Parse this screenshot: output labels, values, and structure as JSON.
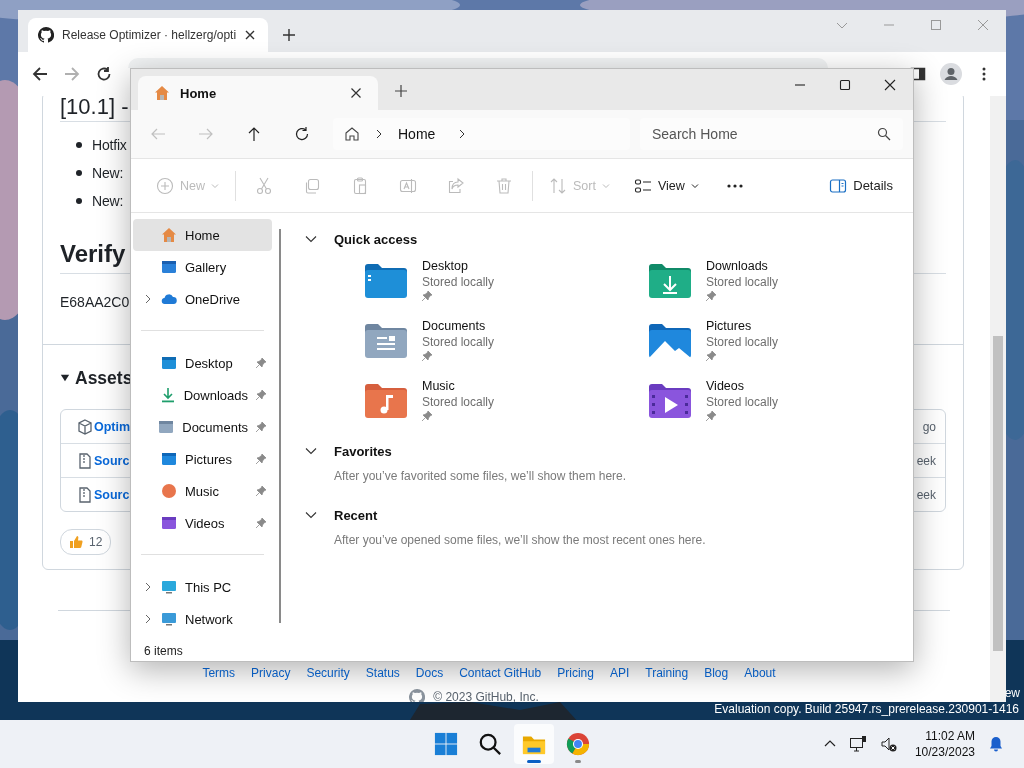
{
  "browser": {
    "tab": {
      "title": "Release Optimizer · hellzerg/opti",
      "selected": true
    },
    "nav": [
      {
        "kind": "back",
        "disabled": false
      },
      {
        "kind": "forward",
        "disabled": true
      },
      {
        "kind": "reload",
        "disabled": false
      }
    ],
    "page": {
      "release_heading": "[10.1] -",
      "notes": [
        "Hotfix",
        "New:",
        "New:"
      ],
      "verify_heading": "Verify",
      "checksum": "E68AA2C0",
      "assets_heading": "Assets",
      "assets": [
        {
          "kind": "package",
          "name": "Optim",
          "date": "go"
        },
        {
          "kind": "zip",
          "name": "Sourc",
          "date": "eek"
        },
        {
          "kind": "zip",
          "name": "Sourc",
          "date": "eek"
        }
      ],
      "reactions": [
        {
          "count": "12"
        }
      ],
      "footer_links": [
        "Terms",
        "Privacy",
        "Security",
        "Status",
        "Docs",
        "Contact GitHub",
        "Pricing",
        "API",
        "Training",
        "Blog",
        "About"
      ],
      "copyright": "© 2023 GitHub, Inc."
    }
  },
  "explorer": {
    "tab": {
      "title": "Home",
      "selected": true
    },
    "nav": [
      {
        "kind": "back",
        "disabled": true
      },
      {
        "kind": "forward",
        "disabled": true
      },
      {
        "kind": "up",
        "disabled": false
      },
      {
        "kind": "refresh",
        "disabled": false
      }
    ],
    "breadcrumb": [
      "Home"
    ],
    "search_placeholder": "Search Home",
    "command_groups": [
      [
        {
          "kind": "new",
          "label": "New",
          "disabled": true
        }
      ],
      [
        {
          "kind": "cut",
          "disabled": true
        },
        {
          "kind": "copy",
          "disabled": true
        },
        {
          "kind": "paste",
          "disabled": true
        },
        {
          "kind": "rename",
          "disabled": true
        },
        {
          "kind": "share",
          "disabled": true
        },
        {
          "kind": "delete",
          "disabled": true
        }
      ],
      [
        {
          "kind": "sort",
          "label": "Sort",
          "disabled": true
        },
        {
          "kind": "view",
          "label": "View",
          "disabled": false
        },
        {
          "kind": "more",
          "disabled": false
        }
      ]
    ],
    "details_label": "Details",
    "sidebar": [
      [
        {
          "kind": "home",
          "label": "Home",
          "selected": true,
          "pinned": false,
          "expandable": false
        },
        {
          "kind": "gallery",
          "label": "Gallery",
          "selected": false,
          "pinned": false,
          "expandable": false
        },
        {
          "kind": "onedrive",
          "label": "OneDrive",
          "selected": false,
          "pinned": false,
          "expandable": true
        }
      ],
      [
        {
          "kind": "desktop",
          "label": "Desktop",
          "selected": false,
          "pinned": true,
          "expandable": false
        },
        {
          "kind": "downloads",
          "label": "Downloads",
          "selected": false,
          "pinned": true,
          "expandable": false
        },
        {
          "kind": "documents",
          "label": "Documents",
          "selected": false,
          "pinned": true,
          "expandable": false
        },
        {
          "kind": "pictures",
          "label": "Pictures",
          "selected": false,
          "pinned": true,
          "expandable": false
        },
        {
          "kind": "music",
          "label": "Music",
          "selected": false,
          "pinned": true,
          "expandable": false
        },
        {
          "kind": "videos",
          "label": "Videos",
          "selected": false,
          "pinned": true,
          "expandable": false
        }
      ],
      [
        {
          "kind": "thispc",
          "label": "This PC",
          "selected": false,
          "pinned": false,
          "expandable": true
        },
        {
          "kind": "network",
          "label": "Network",
          "selected": false,
          "pinned": false,
          "expandable": true
        }
      ]
    ],
    "sections": [
      {
        "title": "Quick access",
        "expanded": true,
        "items": [
          {
            "kind": "desktop",
            "name": "Desktop",
            "subtitle": "Stored locally",
            "pinned": true
          },
          {
            "kind": "downloads",
            "name": "Downloads",
            "subtitle": "Stored locally",
            "pinned": true
          },
          {
            "kind": "documents",
            "name": "Documents",
            "subtitle": "Stored locally",
            "pinned": true
          },
          {
            "kind": "pictures",
            "name": "Pictures",
            "subtitle": "Stored locally",
            "pinned": true
          },
          {
            "kind": "music",
            "name": "Music",
            "subtitle": "Stored locally",
            "pinned": true
          },
          {
            "kind": "videos",
            "name": "Videos",
            "subtitle": "Stored locally",
            "pinned": true
          }
        ]
      },
      {
        "title": "Favorites",
        "expanded": true,
        "message": "After you’ve favorited some files, we’ll show them here."
      },
      {
        "title": "Recent",
        "expanded": true,
        "message": "After you’ve opened some files, we’ll show the most recent ones here."
      }
    ],
    "status_bar": "6 items"
  },
  "desktop": {
    "watermark_tail": "ew",
    "evaluation": "Evaluation copy. Build 25947.rs_prerelease.230901-1416"
  },
  "taskbar": {
    "apps": [
      {
        "kind": "start",
        "selected": false,
        "running": false
      },
      {
        "kind": "search",
        "selected": false,
        "running": false
      },
      {
        "kind": "explorer",
        "selected": true,
        "running": true
      },
      {
        "kind": "chrome",
        "selected": false,
        "running": true
      }
    ],
    "time": "11:02 AM",
    "date": "10/23/2023"
  }
}
